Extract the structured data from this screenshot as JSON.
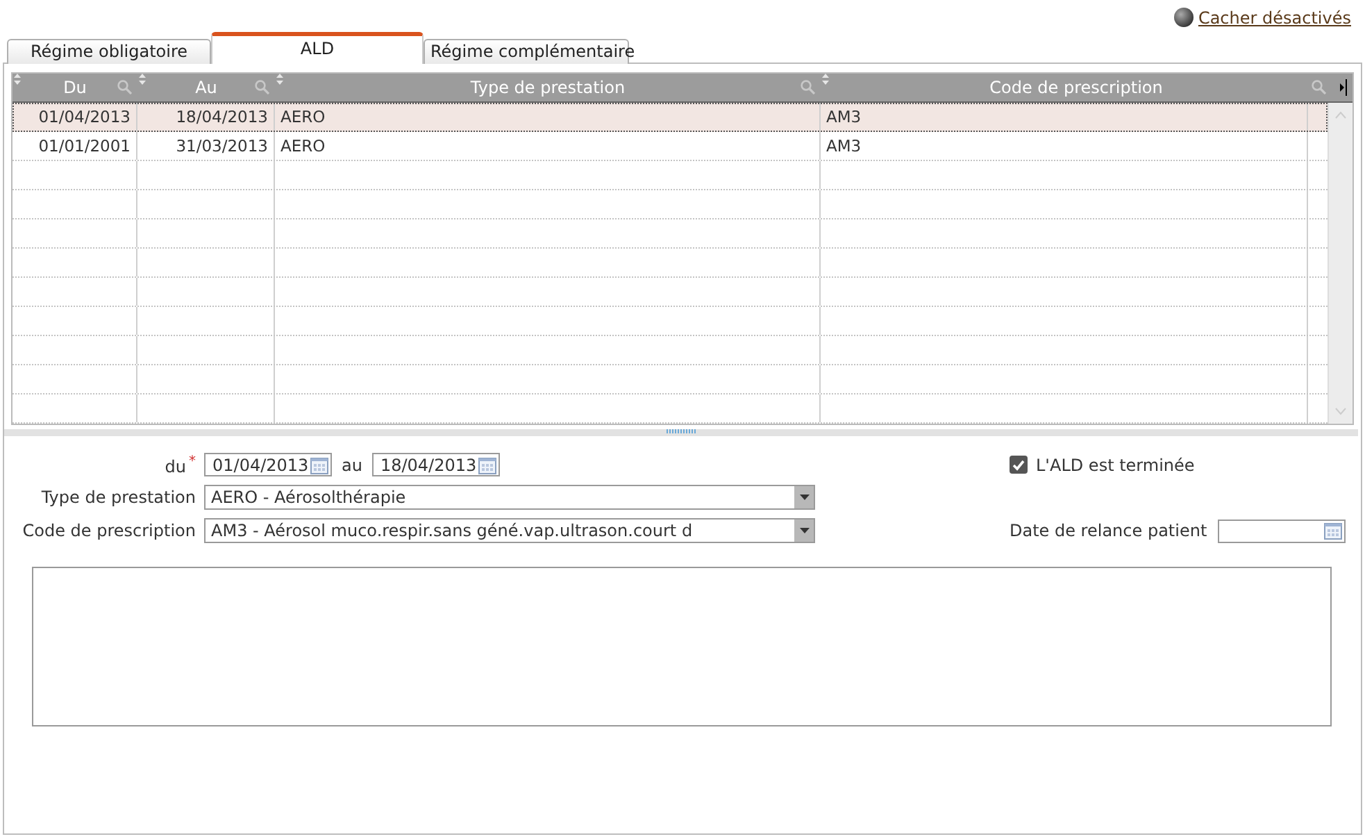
{
  "header_link": {
    "label": "Cacher désactivés"
  },
  "tabs": [
    {
      "label": "Régime obligatoire",
      "selected": false
    },
    {
      "label": "ALD",
      "selected": true
    },
    {
      "label": "Régime complémentaire",
      "selected": false
    }
  ],
  "table": {
    "columns": [
      {
        "label": "Du",
        "kind": "date"
      },
      {
        "label": "Au",
        "kind": "date"
      },
      {
        "label": "Type de prestation",
        "kind": "text"
      },
      {
        "label": "Code de prescription",
        "kind": "text"
      }
    ],
    "rows": [
      {
        "cells": [
          "01/04/2013",
          "18/04/2013",
          "AERO",
          "AM3"
        ],
        "selected": true
      },
      {
        "cells": [
          "01/01/2001",
          "31/03/2013",
          "AERO",
          "AM3"
        ],
        "selected": false
      }
    ]
  },
  "form": {
    "from": {
      "label": "du",
      "required_mark": "*",
      "value": "01/04/2013"
    },
    "to": {
      "label": "au",
      "value": "18/04/2013"
    },
    "ended": {
      "label": "L'ALD est terminée",
      "checked": true
    },
    "type": {
      "label": "Type de prestation",
      "value": "AERO - Aérosolthérapie"
    },
    "code": {
      "label": "Code de prescription",
      "value": "AM3 - Aérosol muco.respir.sans géné.vap.ultrason.court d"
    },
    "reminder": {
      "label": "Date de relance patient"
    }
  }
}
